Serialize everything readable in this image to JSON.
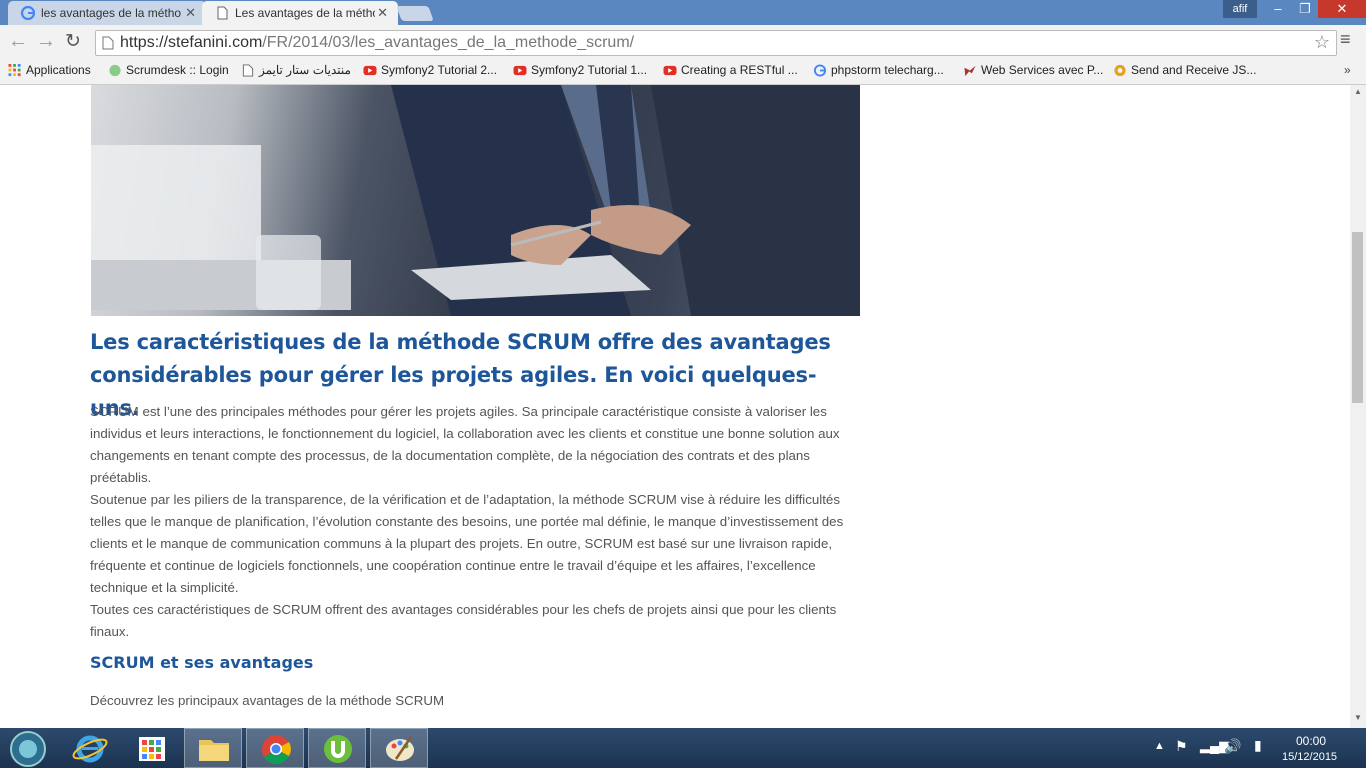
{
  "browser": {
    "tabs": [
      {
        "title": "les avantages de la méthod",
        "icon": "google-icon"
      },
      {
        "title": "Les avantages de la méthod",
        "icon": "page-icon"
      }
    ],
    "user": "afif",
    "url_domain": "https://stefanini.com",
    "url_path": "/FR/2014/03/les_avantages_de_la_methode_scrum/",
    "bookmarks": [
      {
        "label": "Applications",
        "icon": "apps-grid-icon"
      },
      {
        "label": "Scrumdesk :: Login",
        "icon": "scrumdesk-icon"
      },
      {
        "label": "منتديات ستار تايمز",
        "icon": "page-icon"
      },
      {
        "label": "Symfony2 Tutorial 2...",
        "icon": "youtube-icon"
      },
      {
        "label": "Symfony2 Tutorial 1...",
        "icon": "youtube-icon"
      },
      {
        "label": "Creating a RESTful ...",
        "icon": "youtube-icon"
      },
      {
        "label": "phpstorm telecharg...",
        "icon": "google-icon"
      },
      {
        "label": "Web Services avec P...",
        "icon": "bird-icon"
      },
      {
        "label": "Send and Receive JS...",
        "icon": "tool-icon"
      }
    ]
  },
  "article": {
    "headline": "Les caractéristiques de la méthode SCRUM offre des avantages considérables pour gérer les projets agiles. En voici quelques-uns.",
    "paragraphs": [
      "SCRUM est l’une des principales méthodes pour gérer les projets agiles. Sa principale caractéristique consiste à valoriser les individus et leurs interactions, le fonctionnement du logiciel, la collaboration avec les clients et constitue une bonne solution aux changements en tenant compte des processus, de la documentation complète, de la négociation des contrats et des plans préétablis.",
      "Soutenue par les piliers de la transparence, de la vérification et de l’adaptation, la méthode SCRUM vise à réduire les difficultés telles que le manque de planification, l’évolution constante des besoins, une portée mal définie, le manque d’investissement des clients et le manque de communication communs à la plupart des projets. En outre, SCRUM est basé sur une livraison rapide, fréquente et continue de logiciels fonctionnels, une coopération continue entre le travail d’équipe et les affaires, l’excellence technique et la simplicité.",
      "Toutes ces caractéristiques de SCRUM offrent des avantages considérables pour les chefs de projets ainsi que pour les clients finaux."
    ],
    "subheading": "SCRUM et ses avantages",
    "intro_line": "Découvrez les principaux avantages de la méthode SCRUM"
  },
  "taskbar": {
    "apps": [
      "start-orb",
      "ie-icon",
      "apps-grid-icon",
      "file-explorer-icon",
      "chrome-icon",
      "utorrent-icon",
      "paint-icon"
    ],
    "time": "00:00",
    "date": "15/12/2015"
  },
  "colors": {
    "accent": "#1e5799",
    "titlebar": "#5b87c0",
    "body_text": "#555555"
  }
}
